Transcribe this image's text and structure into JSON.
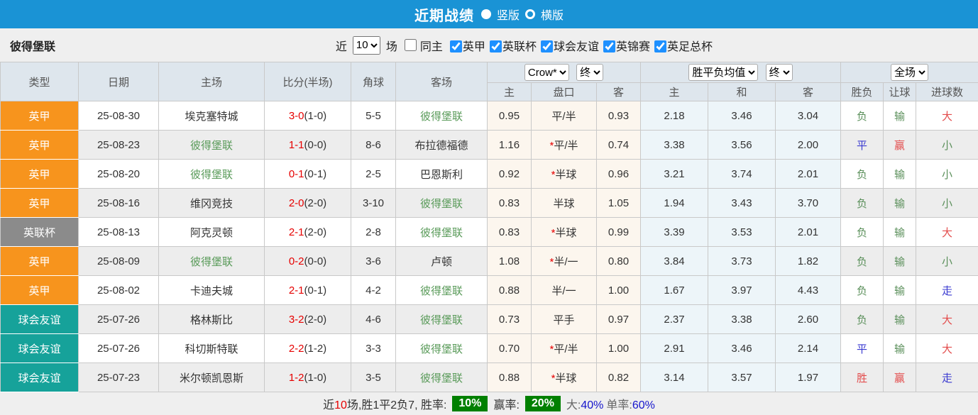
{
  "title_bar": {
    "title": "近期战绩",
    "radio_vertical": "竖版",
    "radio_horizontal": "横版"
  },
  "filter_bar": {
    "team": "彼得堡联",
    "near_label": "近",
    "games_value": "10",
    "games_label": "场",
    "same_home_label": "同主",
    "leagues": [
      {
        "label": "英甲",
        "checked": true
      },
      {
        "label": "英联杯",
        "checked": true
      },
      {
        "label": "球会友谊",
        "checked": true
      },
      {
        "label": "英锦赛",
        "checked": true
      },
      {
        "label": "英足总杯",
        "checked": true
      }
    ]
  },
  "table": {
    "main_headers": [
      "类型",
      "日期",
      "主场",
      "比分(半场)",
      "角球",
      "客场"
    ],
    "sub_headers": [
      "主",
      "盘口",
      "客",
      "主",
      "和",
      "客",
      "胜负",
      "让球",
      "进球数"
    ],
    "dropdowns": {
      "company": "Crow*",
      "company_time": "终",
      "mean": "胜平负均值",
      "mean_time": "终",
      "scope": "全场"
    },
    "rows": [
      {
        "type": "英甲",
        "date": "25-08-30",
        "home": "埃克塞特城",
        "home_self": false,
        "score": "3-0",
        "half": "(1-0)",
        "corner": "5-5",
        "away": "彼得堡联",
        "away_self": true,
        "h_home": "0.95",
        "star": false,
        "handicap": "平/半",
        "h_away": "0.93",
        "m_home": "2.18",
        "m_draw": "3.46",
        "m_away": "3.04",
        "r_wdl": "负",
        "r_let": "输",
        "r_goal": "大"
      },
      {
        "type": "英甲",
        "date": "25-08-23",
        "home": "彼得堡联",
        "home_self": true,
        "score": "1-1",
        "half": "(0-0)",
        "corner": "8-6",
        "away": "布拉德福德",
        "away_self": false,
        "h_home": "1.16",
        "star": true,
        "handicap": "平/半",
        "h_away": "0.74",
        "m_home": "3.38",
        "m_draw": "3.56",
        "m_away": "2.00",
        "r_wdl": "平",
        "r_let": "赢",
        "r_goal": "小"
      },
      {
        "type": "英甲",
        "date": "25-08-20",
        "home": "彼得堡联",
        "home_self": true,
        "score": "0-1",
        "half": "(0-1)",
        "corner": "2-5",
        "away": "巴恩斯利",
        "away_self": false,
        "h_home": "0.92",
        "star": true,
        "handicap": "半球",
        "h_away": "0.96",
        "m_home": "3.21",
        "m_draw": "3.74",
        "m_away": "2.01",
        "r_wdl": "负",
        "r_let": "输",
        "r_goal": "小"
      },
      {
        "type": "英甲",
        "date": "25-08-16",
        "home": "维冈竞技",
        "home_self": false,
        "score": "2-0",
        "half": "(2-0)",
        "corner": "3-10",
        "away": "彼得堡联",
        "away_self": true,
        "h_home": "0.83",
        "star": false,
        "handicap": "半球",
        "h_away": "1.05",
        "m_home": "1.94",
        "m_draw": "3.43",
        "m_away": "3.70",
        "r_wdl": "负",
        "r_let": "输",
        "r_goal": "小"
      },
      {
        "type": "英联杯",
        "date": "25-08-13",
        "home": "阿克灵顿",
        "home_self": false,
        "score": "2-1",
        "half": "(2-0)",
        "corner": "2-8",
        "away": "彼得堡联",
        "away_self": true,
        "h_home": "0.83",
        "star": true,
        "handicap": "半球",
        "h_away": "0.99",
        "m_home": "3.39",
        "m_draw": "3.53",
        "m_away": "2.01",
        "r_wdl": "负",
        "r_let": "输",
        "r_goal": "大"
      },
      {
        "type": "英甲",
        "date": "25-08-09",
        "home": "彼得堡联",
        "home_self": true,
        "score": "0-2",
        "half": "(0-0)",
        "corner": "3-6",
        "away": "卢顿",
        "away_self": false,
        "h_home": "1.08",
        "star": true,
        "handicap": "半/一",
        "h_away": "0.80",
        "m_home": "3.84",
        "m_draw": "3.73",
        "m_away": "1.82",
        "r_wdl": "负",
        "r_let": "输",
        "r_goal": "小"
      },
      {
        "type": "英甲",
        "date": "25-08-02",
        "home": "卡迪夫城",
        "home_self": false,
        "score": "2-1",
        "half": "(0-1)",
        "corner": "4-2",
        "away": "彼得堡联",
        "away_self": true,
        "h_home": "0.88",
        "star": false,
        "handicap": "半/一",
        "h_away": "1.00",
        "m_home": "1.67",
        "m_draw": "3.97",
        "m_away": "4.43",
        "r_wdl": "负",
        "r_let": "输",
        "r_goal": "走"
      },
      {
        "type": "球会友谊",
        "date": "25-07-26",
        "home": "格林斯比",
        "home_self": false,
        "score": "3-2",
        "half": "(2-0)",
        "corner": "4-6",
        "away": "彼得堡联",
        "away_self": true,
        "h_home": "0.73",
        "star": false,
        "handicap": "平手",
        "h_away": "0.97",
        "m_home": "2.37",
        "m_draw": "3.38",
        "m_away": "2.60",
        "r_wdl": "负",
        "r_let": "输",
        "r_goal": "大"
      },
      {
        "type": "球会友谊",
        "date": "25-07-26",
        "home": "科切斯特联",
        "home_self": false,
        "score": "2-2",
        "half": "(1-2)",
        "corner": "3-3",
        "away": "彼得堡联",
        "away_self": true,
        "h_home": "0.70",
        "star": true,
        "handicap": "平/半",
        "h_away": "1.00",
        "m_home": "2.91",
        "m_draw": "3.46",
        "m_away": "2.14",
        "r_wdl": "平",
        "r_let": "输",
        "r_goal": "大"
      },
      {
        "type": "球会友谊",
        "date": "25-07-23",
        "home": "米尔顿凯恩斯",
        "home_self": false,
        "score": "1-2",
        "half": "(1-0)",
        "corner": "3-5",
        "away": "彼得堡联",
        "away_self": true,
        "h_home": "0.88",
        "star": true,
        "handicap": "半球",
        "h_away": "0.82",
        "m_home": "3.14",
        "m_draw": "3.57",
        "m_away": "1.97",
        "r_wdl": "胜",
        "r_let": "赢",
        "r_goal": "走"
      }
    ]
  },
  "footer": {
    "near_label": "近",
    "count": "10",
    "middle": "场,胜1平2负7, 胜率:",
    "win_rate": "10%",
    "odds_win_label": "赢率:",
    "odds_win_rate": "20%",
    "big_label": "大:",
    "big_value": "40%",
    "single_label": "单率:",
    "single_value": "60%"
  },
  "colors": {
    "topbar_blue": "#1a93d5",
    "type_bg": {
      "英甲": "#f7941d",
      "英联杯": "#8b8b8b",
      "球会友谊": "#16a29a"
    },
    "self_team_green": "#5a9b5a",
    "score_red": "#e60000",
    "result_text": {
      "胜": "#e34d4d",
      "平": "#3a3ad0",
      "负": "#5a8f5a",
      "赢": "#e34d4d",
      "输": "#5a8f5a",
      "大": "#e34d4d",
      "小": "#5a8f5a",
      "走": "#3a3ad0"
    }
  }
}
